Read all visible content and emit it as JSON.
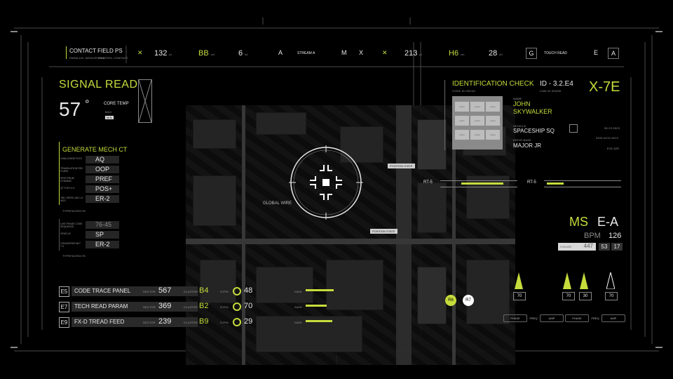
{
  "header": {
    "title": "CONTACT FIELD PS",
    "sub1": "PARALLEL WHOLEFIELD",
    "sub2": "CONTROL CONTACT",
    "items": [
      {
        "value": "132",
        "unit": "pt"
      },
      {
        "value": "BB",
        "unit": "cm"
      },
      {
        "value": "6",
        "unit": "kd"
      },
      {
        "value": "A"
      },
      {
        "value": "STREAM A"
      },
      {
        "value": "M"
      },
      {
        "value": "X"
      },
      {
        "value": "213",
        "unit": "pt"
      },
      {
        "value": "H6",
        "unit": "cm"
      },
      {
        "value": "28",
        "unit": "kd"
      },
      {
        "value": "G"
      },
      {
        "value": "TOUCH READ"
      },
      {
        "value": "E"
      },
      {
        "value": "A"
      }
    ]
  },
  "signal": {
    "title": "SIGNAL READ",
    "temp": "57",
    "deg": "°",
    "core_label": "CORE TEMP",
    "max_label": "MAX",
    "min_label": "MIN"
  },
  "mech": {
    "title": "GENERATE MECH CT",
    "rows": [
      {
        "label": "CHALLENGE FLEX",
        "value": "AQ"
      },
      {
        "label": "TRANSLATION REV FLARE",
        "value": "OOP"
      },
      {
        "label": "SPECTRUM DYNAMIC",
        "value": "PREF"
      },
      {
        "label": "QT FLEX 4.4",
        "value": "POS+"
      },
      {
        "label": "JSK VISOR LAN 1.5 NOS",
        "value": "ER-2"
      }
    ],
    "rows2": [
      {
        "label": "LIVE PHASE CODE SEQUENCE",
        "value": "76-45"
      },
      {
        "label": "VEHICLE",
        "value": "SP"
      },
      {
        "label": "CONVERTER BLT 7.4",
        "value": "ER-2"
      }
    ],
    "foot1": "TYPEFACED178",
    "foot2": "TYPEFACED178"
  },
  "feeds": [
    {
      "code": "E5",
      "name": "CODE TRACE PANEL",
      "sector": "567",
      "cluster": "B4",
      "val": "48"
    },
    {
      "code": "E7",
      "name": "TECH READ PARAM",
      "sector": "369",
      "cluster": "B2",
      "val": "70"
    },
    {
      "code": "E9",
      "name": "FX-D TREAD FEED",
      "sector": "239",
      "cluster": "B9",
      "val": "29"
    }
  ],
  "feed_labels": {
    "sector": "SECTOR",
    "cluster": "CLUSTER",
    "spin": "S-PIN",
    "gain": "GAIN"
  },
  "map": {
    "global": "GLOBAL WIRE",
    "pos1": "POSITION STATE",
    "pos2": "POSITION STATE"
  },
  "ident": {
    "title": "IDENTIFICATION CHECK",
    "code": "CODE ID 032/43",
    "id": "ID - 3.2.E4",
    "link": "LINK ID 034/06",
    "tag": "X-7E",
    "photo_label": "photo",
    "name_label": "NAME",
    "name1": "JOHN",
    "name2": "SKYWALKER",
    "vehicle_label": "VEHICLE",
    "vehicle": "SPACESHIP SQ",
    "rank_label": "DRIVE BASE",
    "rank": "MAJOR JR",
    "date": "95.23.3023",
    "phone": "3325-5212-5212",
    "code2": "E29-32R"
  },
  "rt": {
    "left": "RT-5",
    "right": "RT-5"
  },
  "ms": {
    "label": "MS",
    "value": "E-A",
    "bpm_label": "BPM",
    "bpm": "126",
    "field_label": "FIGURE",
    "field": "447",
    "n1": "53",
    "n2": "17"
  },
  "badges": {
    "b1": "R6",
    "b2": "R7"
  },
  "gauges": [
    "70",
    "70",
    "30",
    "70"
  ],
  "pills": [
    "PHASE",
    "FREQ",
    "AMP",
    "PHASE",
    "FREQ",
    "AMP"
  ],
  "colors": {
    "accent": "#c6dc3c",
    "bg": "#000000"
  }
}
